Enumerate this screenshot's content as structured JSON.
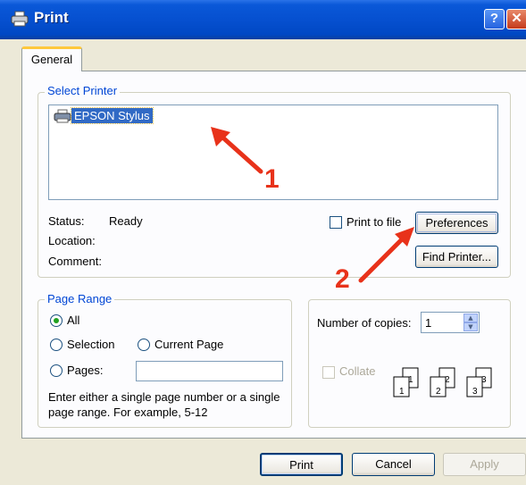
{
  "window": {
    "title": "Print",
    "help_label": "?",
    "close_label": "✕"
  },
  "tabs": [
    {
      "label": "General",
      "selected": true
    }
  ],
  "select_printer": {
    "legend": "Select Printer",
    "printers": [
      {
        "name": "EPSON Stylus",
        "selected": true
      }
    ],
    "status_label": "Status:",
    "status_value": "Ready",
    "location_label": "Location:",
    "comment_label": "Comment:",
    "print_to_file_label": "Print to file",
    "print_to_file_checked": false,
    "preferences_label": "Preferences",
    "find_printer_label": "Find Printer..."
  },
  "page_range": {
    "legend": "Page Range",
    "options": [
      {
        "label": "All",
        "checked": true
      },
      {
        "label": "Selection",
        "checked": false
      },
      {
        "label": "Current Page",
        "checked": false
      },
      {
        "label": "Pages:",
        "checked": false
      }
    ],
    "pages_value": "",
    "help_line1": "Enter either a single page number or a single",
    "help_line2": "page range.  For example, 5-12"
  },
  "copies": {
    "label": "Number of copies:",
    "value": "1",
    "collate_label": "Collate",
    "collate_checked": false,
    "collate_enabled": false
  },
  "buttons": {
    "print": "Print",
    "cancel": "Cancel",
    "apply": "Apply"
  },
  "annotations": [
    {
      "number": "1",
      "color": "#e8321a"
    },
    {
      "number": "2",
      "color": "#e8321a"
    }
  ]
}
